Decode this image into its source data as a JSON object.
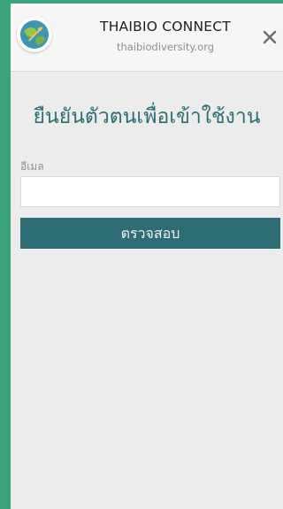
{
  "header": {
    "title": "THAIBIO CONNECT",
    "subtitle": "thaibiodiversity.org",
    "logo_icon": "globe-leaf-logo",
    "close_icon": "close-icon"
  },
  "form": {
    "heading": "ยืนยันตัวตนเพื่อเข้าใช้งาน",
    "email_label": "อีเมล",
    "email_value": "",
    "email_placeholder": "",
    "submit_label": "ตรวจสอบ"
  },
  "colors": {
    "accent": "#2d6d74",
    "side_border": "#3ba37b",
    "background": "#ececed"
  }
}
